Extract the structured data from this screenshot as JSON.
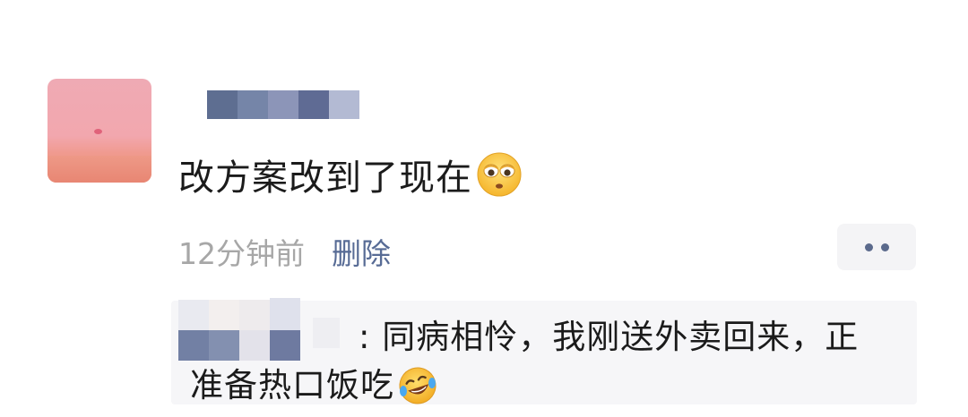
{
  "post": {
    "avatar_icon": "sunset-avatar-image",
    "text": "改方案改到了现在",
    "emoji": "rolling-eyes-face-emoji",
    "time": "12分钟前",
    "delete_label": "删除",
    "more_icon": "more-dots-icon"
  },
  "comment": {
    "line1": ": 同病相怜，我刚送外卖回来，正",
    "line2": "准备热口饭吃",
    "emoji": "laughing-crying-face-emoji"
  },
  "colors": {
    "link": "#576b95",
    "meta_gray": "#a7a7a7",
    "comment_bg": "#f6f6f8",
    "text": "#1b1b1b"
  }
}
